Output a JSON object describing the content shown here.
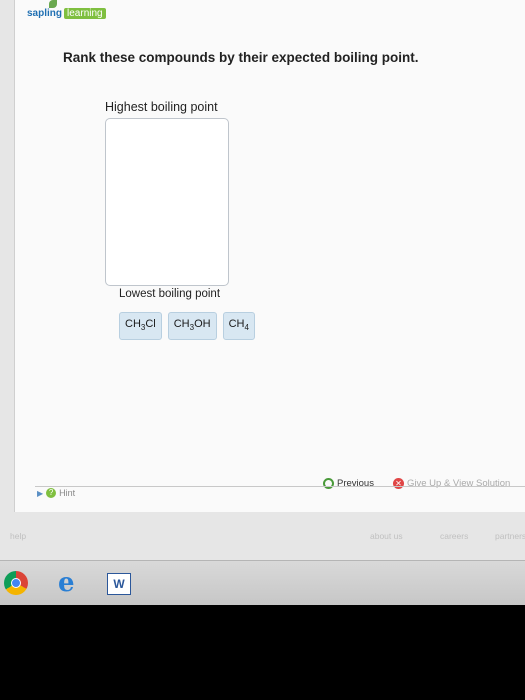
{
  "logo": {
    "brand": "sapling",
    "suffix": "learning"
  },
  "question": "Rank these compounds by their expected boiling point.",
  "ranking": {
    "highest_label": "Highest boiling point",
    "lowest_label": "Lowest boiling point",
    "chips": [
      {
        "formula_a": "CH",
        "sub": "3",
        "formula_b": "Cl"
      },
      {
        "formula_a": "CH",
        "sub": "3",
        "formula_b": "OH"
      },
      {
        "formula_a": "CH",
        "sub": "4",
        "formula_b": ""
      }
    ]
  },
  "nav": {
    "hint_label": "Hint",
    "previous_label": "Previous",
    "giveup_label": "Give Up & View Solution"
  },
  "footer": {
    "help": "help",
    "about": "about us",
    "careers": "careers",
    "partners": "partners"
  },
  "taskbar": {
    "word_letter": "W"
  },
  "colors": {
    "chip_bg": "#d8e7f2",
    "brand_blue": "#1f6fb2",
    "brand_green": "#7fbf3f"
  }
}
